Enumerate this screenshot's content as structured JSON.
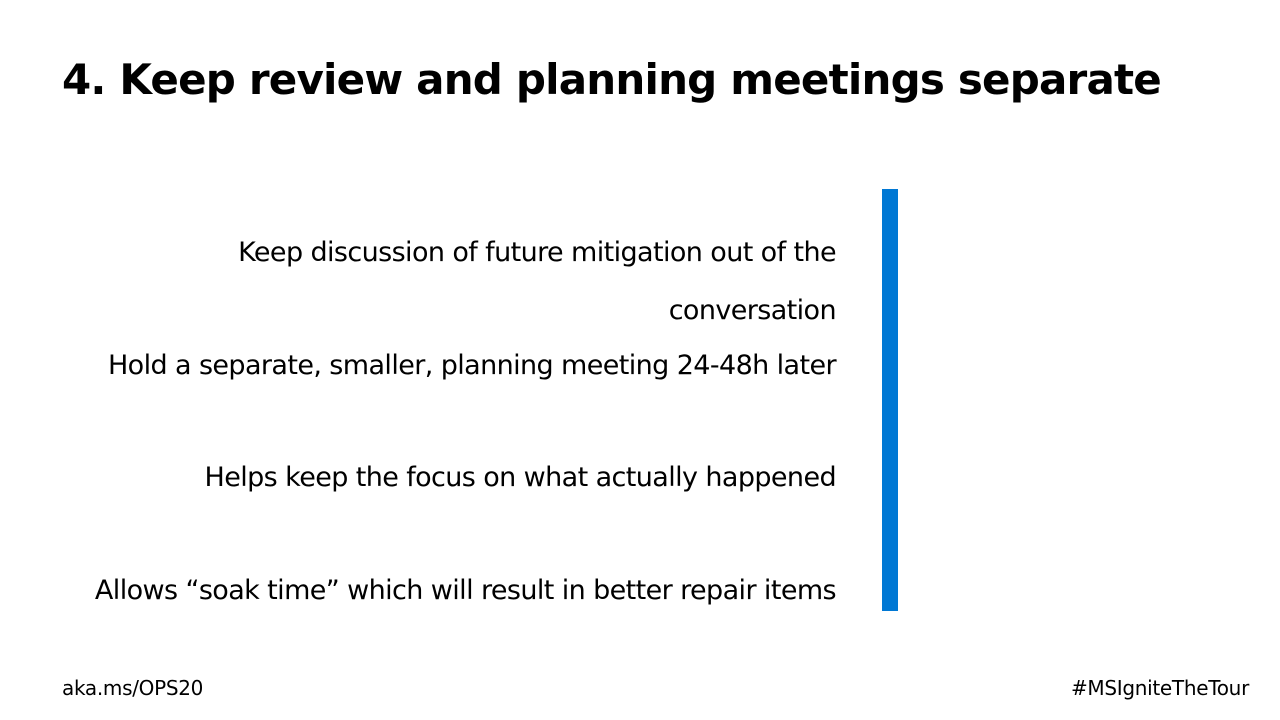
{
  "slide": {
    "title": "4. Keep review and planning meetings separate",
    "bullets": [
      "Keep discussion of future mitigation out of the conversation",
      "Hold a separate, smaller, planning meeting 24-48h later",
      "Helps keep the focus on what actually happened",
      "Allows “soak time” which will result in better repair items"
    ],
    "accent_color": "#0078D4"
  },
  "footer": {
    "left_link": "aka.ms/OPS20",
    "hashtag": "#MSIgniteTheTour"
  }
}
